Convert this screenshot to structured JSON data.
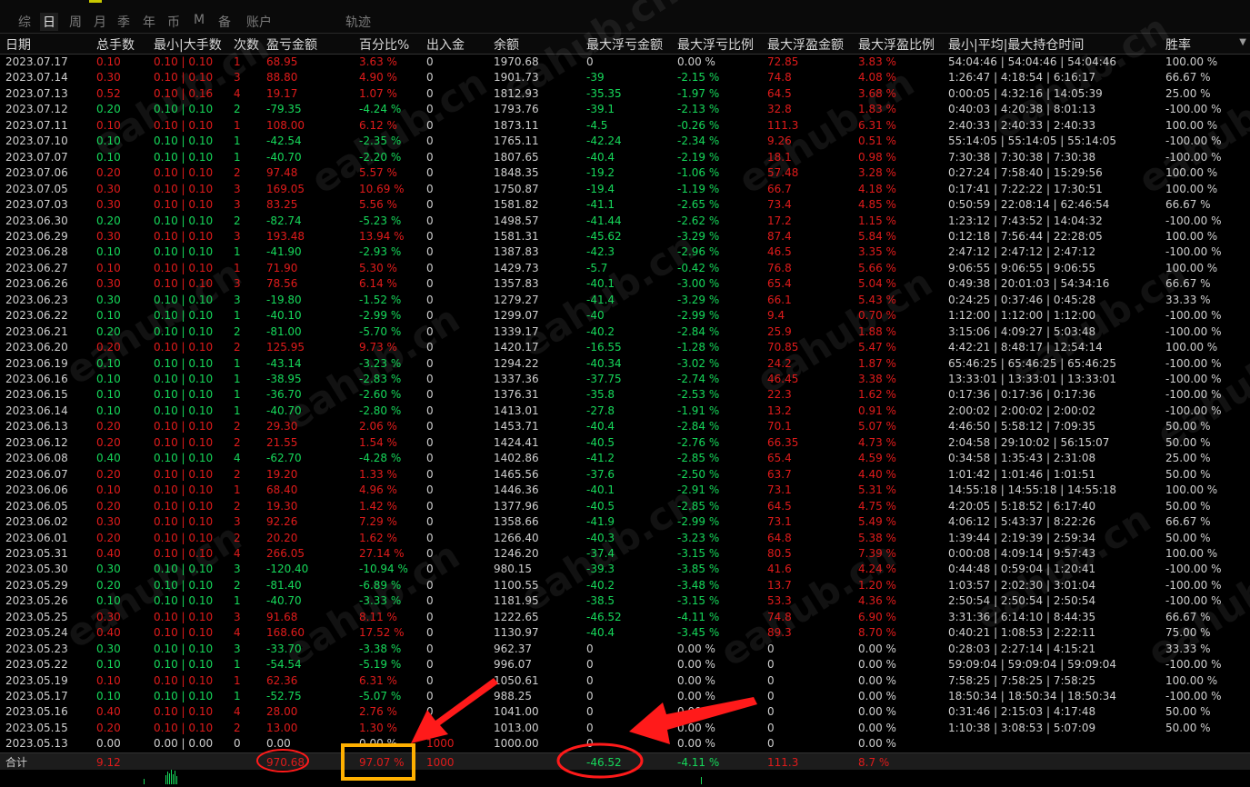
{
  "tabs": [
    "综",
    "日",
    "周",
    "月",
    "季",
    "年",
    "币",
    "M",
    "备",
    "账户",
    "轨迹"
  ],
  "active_tab": "日",
  "columns": [
    "日期",
    "总手数",
    "最小|大手数",
    "次数",
    "盈亏金额",
    "百分比%",
    "出入金",
    "余额",
    "最大浮亏金额",
    "最大浮亏比例",
    "最大浮盈金额",
    "最大浮盈比例",
    "最小|平均|最大持仓时间",
    "胜率"
  ],
  "watermark": "eahub.cn",
  "colors": {
    "profit": "#e01b1b",
    "loss": "#16d85a",
    "neutral": "#cfcfcf",
    "highlight_circle": "#ff1a1a",
    "highlight_box": "#ffb000"
  },
  "rows": [
    {
      "c": [
        "2023.07.17",
        "0.10",
        "0.10 | 0.10",
        "1",
        "68.95",
        "3.63 %",
        "0",
        "1970.68",
        "0",
        "0.00 %",
        "72.85",
        "3.83 %",
        "54:04:46 | 54:04:46 | 54:04:46",
        "100.00 %"
      ],
      "k": "p"
    },
    {
      "c": [
        "2023.07.14",
        "0.30",
        "0.10 | 0.10",
        "3",
        "88.80",
        "4.90 %",
        "0",
        "1901.73",
        "-39",
        "-2.15 %",
        "74.8",
        "4.08 %",
        "1:26:47 | 4:18:54 | 6:16:17",
        "66.67 %"
      ],
      "k": "p"
    },
    {
      "c": [
        "2023.07.13",
        "0.52",
        "0.10 | 0.16",
        "4",
        "19.17",
        "1.07 %",
        "0",
        "1812.93",
        "-35.35",
        "-1.97 %",
        "64.5",
        "3.68 %",
        "0:00:05 | 4:32:16 | 14:05:39",
        "25.00 %"
      ],
      "k": "p"
    },
    {
      "c": [
        "2023.07.12",
        "0.20",
        "0.10 | 0.10",
        "2",
        "-79.35",
        "-4.24 %",
        "0",
        "1793.76",
        "-39.1",
        "-2.13 %",
        "32.8",
        "1.83 %",
        "0:40:03 | 4:20:38 | 8:01:13",
        "-100.00 %"
      ],
      "k": "l"
    },
    {
      "c": [
        "2023.07.11",
        "0.10",
        "0.10 | 0.10",
        "1",
        "108.00",
        "6.12 %",
        "0",
        "1873.11",
        "-4.5",
        "-0.26 %",
        "111.3",
        "6.31 %",
        "2:40:33 | 2:40:33 | 2:40:33",
        "100.00 %"
      ],
      "k": "p"
    },
    {
      "c": [
        "2023.07.10",
        "0.10",
        "0.10 | 0.10",
        "1",
        "-42.54",
        "-2.35 %",
        "0",
        "1765.11",
        "-42.24",
        "-2.34 %",
        "9.26",
        "0.51 %",
        "55:14:05 | 55:14:05 | 55:14:05",
        "-100.00 %"
      ],
      "k": "l"
    },
    {
      "c": [
        "2023.07.07",
        "0.10",
        "0.10 | 0.10",
        "1",
        "-40.70",
        "-2.20 %",
        "0",
        "1807.65",
        "-40.4",
        "-2.19 %",
        "18.1",
        "0.98 %",
        "7:30:38 | 7:30:38 | 7:30:38",
        "-100.00 %"
      ],
      "k": "l"
    },
    {
      "c": [
        "2023.07.06",
        "0.20",
        "0.10 | 0.10",
        "2",
        "97.48",
        "5.57 %",
        "0",
        "1848.35",
        "-19.2",
        "-1.06 %",
        "57.48",
        "3.28 %",
        "0:27:24 | 7:58:40 | 15:29:56",
        "100.00 %"
      ],
      "k": "p"
    },
    {
      "c": [
        "2023.07.05",
        "0.30",
        "0.10 | 0.10",
        "3",
        "169.05",
        "10.69 %",
        "0",
        "1750.87",
        "-19.4",
        "-1.19 %",
        "66.7",
        "4.18 %",
        "0:17:41 | 7:22:22 | 17:30:51",
        "100.00 %"
      ],
      "k": "p"
    },
    {
      "c": [
        "2023.07.03",
        "0.30",
        "0.10 | 0.10",
        "3",
        "83.25",
        "5.56 %",
        "0",
        "1581.82",
        "-41.1",
        "-2.65 %",
        "73.4",
        "4.85 %",
        "0:50:59 | 22:08:14 | 62:46:54",
        "66.67 %"
      ],
      "k": "p"
    },
    {
      "c": [
        "2023.06.30",
        "0.20",
        "0.10 | 0.10",
        "2",
        "-82.74",
        "-5.23 %",
        "0",
        "1498.57",
        "-41.44",
        "-2.62 %",
        "17.2",
        "1.15 %",
        "1:23:12 | 7:43:52 | 14:04:32",
        "-100.00 %"
      ],
      "k": "l"
    },
    {
      "c": [
        "2023.06.29",
        "0.30",
        "0.10 | 0.10",
        "3",
        "193.48",
        "13.94 %",
        "0",
        "1581.31",
        "-45.62",
        "-3.29 %",
        "87.4",
        "5.84 %",
        "0:12:18 | 7:56:44 | 22:28:05",
        "100.00 %"
      ],
      "k": "p"
    },
    {
      "c": [
        "2023.06.28",
        "0.10",
        "0.10 | 0.10",
        "1",
        "-41.90",
        "-2.93 %",
        "0",
        "1387.83",
        "-42.3",
        "-2.96 %",
        "46.5",
        "3.35 %",
        "2:47:12 | 2:47:12 | 2:47:12",
        "-100.00 %"
      ],
      "k": "l"
    },
    {
      "c": [
        "2023.06.27",
        "0.10",
        "0.10 | 0.10",
        "1",
        "71.90",
        "5.30 %",
        "0",
        "1429.73",
        "-5.7",
        "-0.42 %",
        "76.8",
        "5.66 %",
        "9:06:55 | 9:06:55 | 9:06:55",
        "100.00 %"
      ],
      "k": "p"
    },
    {
      "c": [
        "2023.06.26",
        "0.30",
        "0.10 | 0.10",
        "3",
        "78.56",
        "6.14 %",
        "0",
        "1357.83",
        "-40.1",
        "-3.00 %",
        "65.4",
        "5.04 %",
        "0:49:38 | 20:01:03 | 54:34:16",
        "66.67 %"
      ],
      "k": "p"
    },
    {
      "c": [
        "2023.06.23",
        "0.30",
        "0.10 | 0.10",
        "3",
        "-19.80",
        "-1.52 %",
        "0",
        "1279.27",
        "-41.4",
        "-3.29 %",
        "66.1",
        "5.43 %",
        "0:24:25 | 0:37:46 | 0:45:28",
        "33.33 %"
      ],
      "k": "l"
    },
    {
      "c": [
        "2023.06.22",
        "0.10",
        "0.10 | 0.10",
        "1",
        "-40.10",
        "-2.99 %",
        "0",
        "1299.07",
        "-40",
        "-2.99 %",
        "9.4",
        "0.70 %",
        "1:12:00 | 1:12:00 | 1:12:00",
        "-100.00 %"
      ],
      "k": "l"
    },
    {
      "c": [
        "2023.06.21",
        "0.20",
        "0.10 | 0.10",
        "2",
        "-81.00",
        "-5.70 %",
        "0",
        "1339.17",
        "-40.2",
        "-2.84 %",
        "25.9",
        "1.88 %",
        "3:15:06 | 4:09:27 | 5:03:48",
        "-100.00 %"
      ],
      "k": "l"
    },
    {
      "c": [
        "2023.06.20",
        "0.20",
        "0.10 | 0.10",
        "2",
        "125.95",
        "9.73 %",
        "0",
        "1420.17",
        "-16.55",
        "-1.28 %",
        "70.85",
        "5.47 %",
        "4:42:21 | 8:48:17 | 12:54:14",
        "100.00 %"
      ],
      "k": "p"
    },
    {
      "c": [
        "2023.06.19",
        "0.10",
        "0.10 | 0.10",
        "1",
        "-43.14",
        "-3.23 %",
        "0",
        "1294.22",
        "-40.34",
        "-3.02 %",
        "24.2",
        "1.87 %",
        "65:46:25 | 65:46:25 | 65:46:25",
        "-100.00 %"
      ],
      "k": "l"
    },
    {
      "c": [
        "2023.06.16",
        "0.10",
        "0.10 | 0.10",
        "1",
        "-38.95",
        "-2.83 %",
        "0",
        "1337.36",
        "-37.75",
        "-2.74 %",
        "46.45",
        "3.38 %",
        "13:33:01 | 13:33:01 | 13:33:01",
        "-100.00 %"
      ],
      "k": "l"
    },
    {
      "c": [
        "2023.06.15",
        "0.10",
        "0.10 | 0.10",
        "1",
        "-36.70",
        "-2.60 %",
        "0",
        "1376.31",
        "-35.8",
        "-2.53 %",
        "22.3",
        "1.62 %",
        "0:17:36 | 0:17:36 | 0:17:36",
        "-100.00 %"
      ],
      "k": "l"
    },
    {
      "c": [
        "2023.06.14",
        "0.10",
        "0.10 | 0.10",
        "1",
        "-40.70",
        "-2.80 %",
        "0",
        "1413.01",
        "-27.8",
        "-1.91 %",
        "13.2",
        "0.91 %",
        "2:00:02 | 2:00:02 | 2:00:02",
        "-100.00 %"
      ],
      "k": "l"
    },
    {
      "c": [
        "2023.06.13",
        "0.20",
        "0.10 | 0.10",
        "2",
        "29.30",
        "2.06 %",
        "0",
        "1453.71",
        "-40.4",
        "-2.84 %",
        "70.1",
        "5.07 %",
        "4:46:50 | 5:58:12 | 7:09:35",
        "50.00 %"
      ],
      "k": "p"
    },
    {
      "c": [
        "2023.06.12",
        "0.20",
        "0.10 | 0.10",
        "2",
        "21.55",
        "1.54 %",
        "0",
        "1424.41",
        "-40.5",
        "-2.76 %",
        "66.35",
        "4.73 %",
        "2:04:58 | 29:10:02 | 56:15:07",
        "50.00 %"
      ],
      "k": "p"
    },
    {
      "c": [
        "2023.06.08",
        "0.40",
        "0.10 | 0.10",
        "4",
        "-62.70",
        "-4.28 %",
        "0",
        "1402.86",
        "-41.2",
        "-2.85 %",
        "65.4",
        "4.59 %",
        "0:34:58 | 1:35:43 | 2:31:08",
        "25.00 %"
      ],
      "k": "l"
    },
    {
      "c": [
        "2023.06.07",
        "0.20",
        "0.10 | 0.10",
        "2",
        "19.20",
        "1.33 %",
        "0",
        "1465.56",
        "-37.6",
        "-2.50 %",
        "63.7",
        "4.40 %",
        "1:01:42 | 1:01:46 | 1:01:51",
        "50.00 %"
      ],
      "k": "p"
    },
    {
      "c": [
        "2023.06.06",
        "0.10",
        "0.10 | 0.10",
        "1",
        "68.40",
        "4.96 %",
        "0",
        "1446.36",
        "-40.1",
        "-2.91 %",
        "73.1",
        "5.31 %",
        "14:55:18 | 14:55:18 | 14:55:18",
        "100.00 %"
      ],
      "k": "p"
    },
    {
      "c": [
        "2023.06.05",
        "0.20",
        "0.10 | 0.10",
        "2",
        "19.30",
        "1.42 %",
        "0",
        "1377.96",
        "-40.5",
        "-2.85 %",
        "64.5",
        "4.75 %",
        "4:20:05 | 5:18:52 | 6:17:40",
        "50.00 %"
      ],
      "k": "p"
    },
    {
      "c": [
        "2023.06.02",
        "0.30",
        "0.10 | 0.10",
        "3",
        "92.26",
        "7.29 %",
        "0",
        "1358.66",
        "-41.9",
        "-2.99 %",
        "73.1",
        "5.49 %",
        "4:06:12 | 5:43:37 | 8:22:26",
        "66.67 %"
      ],
      "k": "p"
    },
    {
      "c": [
        "2023.06.01",
        "0.20",
        "0.10 | 0.10",
        "2",
        "20.20",
        "1.62 %",
        "0",
        "1266.40",
        "-40.3",
        "-3.23 %",
        "64.8",
        "5.38 %",
        "1:39:44 | 2:19:39 | 2:59:34",
        "50.00 %"
      ],
      "k": "p"
    },
    {
      "c": [
        "2023.05.31",
        "0.40",
        "0.10 | 0.10",
        "4",
        "266.05",
        "27.14 %",
        "0",
        "1246.20",
        "-37.4",
        "-3.15 %",
        "80.5",
        "7.39 %",
        "0:00:08 | 4:09:14 | 9:57:43",
        "100.00 %"
      ],
      "k": "p"
    },
    {
      "c": [
        "2023.05.30",
        "0.30",
        "0.10 | 0.10",
        "3",
        "-120.40",
        "-10.94 %",
        "0",
        "980.15",
        "-39.3",
        "-3.85 %",
        "41.6",
        "4.24 %",
        "0:44:48 | 0:59:04 | 1:20:41",
        "-100.00 %"
      ],
      "k": "l"
    },
    {
      "c": [
        "2023.05.29",
        "0.20",
        "0.10 | 0.10",
        "2",
        "-81.40",
        "-6.89 %",
        "0",
        "1100.55",
        "-40.2",
        "-3.48 %",
        "13.7",
        "1.20 %",
        "1:03:57 | 2:02:30 | 3:01:04",
        "-100.00 %"
      ],
      "k": "l"
    },
    {
      "c": [
        "2023.05.26",
        "0.10",
        "0.10 | 0.10",
        "1",
        "-40.70",
        "-3.33 %",
        "0",
        "1181.95",
        "-38.5",
        "-3.15 %",
        "53.3",
        "4.36 %",
        "2:50:54 | 2:50:54 | 2:50:54",
        "-100.00 %"
      ],
      "k": "l"
    },
    {
      "c": [
        "2023.05.25",
        "0.30",
        "0.10 | 0.10",
        "3",
        "91.68",
        "8.11 %",
        "0",
        "1222.65",
        "-46.52",
        "-4.11 %",
        "74.8",
        "6.90 %",
        "3:31:36 | 6:14:10 | 8:44:35",
        "66.67 %"
      ],
      "k": "p"
    },
    {
      "c": [
        "2023.05.24",
        "0.40",
        "0.10 | 0.10",
        "4",
        "168.60",
        "17.52 %",
        "0",
        "1130.97",
        "-40.4",
        "-3.45 %",
        "89.3",
        "8.70 %",
        "0:40:21 | 1:08:53 | 2:22:11",
        "75.00 %"
      ],
      "k": "p"
    },
    {
      "c": [
        "2023.05.23",
        "0.30",
        "0.10 | 0.10",
        "3",
        "-33.70",
        "-3.38 %",
        "0",
        "962.37",
        "0",
        "0.00 %",
        "0",
        "0.00 %",
        "0:28:03 | 2:27:14 | 4:15:21",
        "33.33 %"
      ],
      "k": "l"
    },
    {
      "c": [
        "2023.05.22",
        "0.10",
        "0.10 | 0.10",
        "1",
        "-54.54",
        "-5.19 %",
        "0",
        "996.07",
        "0",
        "0.00 %",
        "0",
        "0.00 %",
        "59:09:04 | 59:09:04 | 59:09:04",
        "-100.00 %"
      ],
      "k": "l"
    },
    {
      "c": [
        "2023.05.19",
        "0.10",
        "0.10 | 0.10",
        "1",
        "62.36",
        "6.31 %",
        "0",
        "1050.61",
        "0",
        "0.00 %",
        "0",
        "0.00 %",
        "7:58:25 | 7:58:25 | 7:58:25",
        "100.00 %"
      ],
      "k": "p"
    },
    {
      "c": [
        "2023.05.17",
        "0.10",
        "0.10 | 0.10",
        "1",
        "-52.75",
        "-5.07 %",
        "0",
        "988.25",
        "0",
        "0.00 %",
        "0",
        "0.00 %",
        "18:50:34 | 18:50:34 | 18:50:34",
        "-100.00 %"
      ],
      "k": "l"
    },
    {
      "c": [
        "2023.05.16",
        "0.40",
        "0.10 | 0.10",
        "4",
        "28.00",
        "2.76 %",
        "0",
        "1041.00",
        "0",
        "0.00 %",
        "0",
        "0.00 %",
        "0:31:46 | 2:15:03 | 4:17:48",
        "50.00 %"
      ],
      "k": "p"
    },
    {
      "c": [
        "2023.05.15",
        "0.20",
        "0.10 | 0.10",
        "2",
        "13.00",
        "1.30 %",
        "0",
        "1013.00",
        "0",
        "0.00 %",
        "0",
        "0.00 %",
        "1:10:38 | 3:08:53 | 5:07:09",
        "50.00 %"
      ],
      "k": "p"
    },
    {
      "c": [
        "2023.05.13",
        "0.00",
        "0.00 | 0.00",
        "0",
        "0.00",
        "0.00 %",
        "1000",
        "1000.00",
        "0",
        "0.00 %",
        "0",
        "0.00 %",
        "",
        ""
      ],
      "k": "n"
    }
  ],
  "total": {
    "label": "合计",
    "lots": "9.12",
    "pnl": "970.68",
    "percent": "97.07 %",
    "deposit": "1000",
    "max_float_loss": "-46.52",
    "max_float_loss_pct": "-4.11 %",
    "max_float_profit": "111.3",
    "max_float_profit_pct": "8.7 %"
  }
}
